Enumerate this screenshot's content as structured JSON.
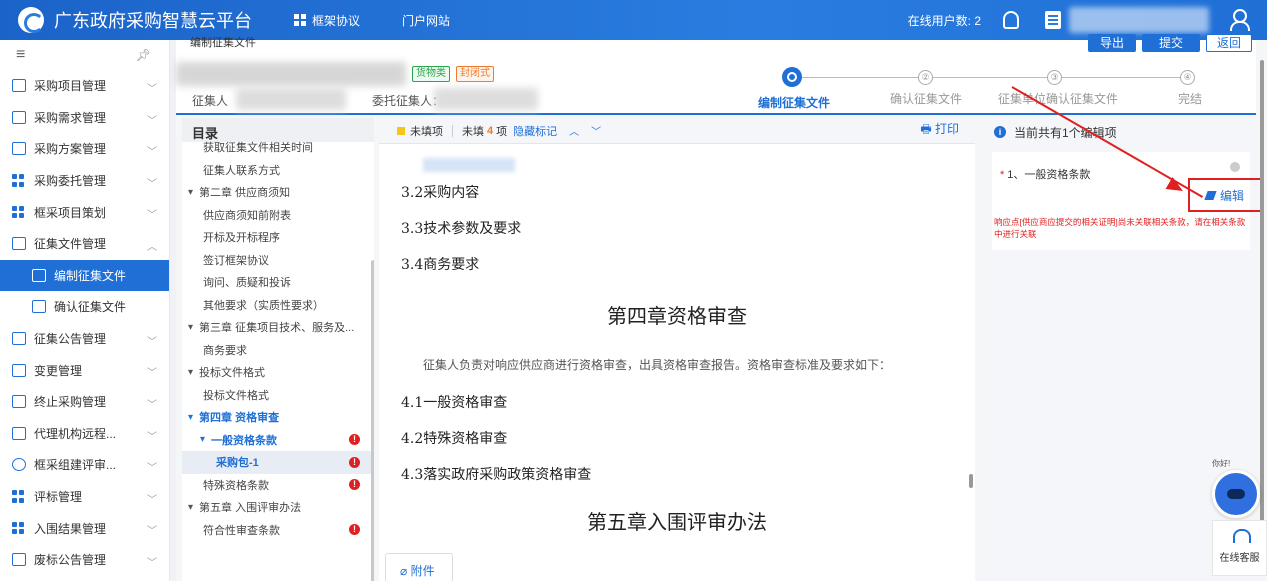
{
  "app": {
    "title": "广东政府采购智慧云平台"
  },
  "topnav": {
    "items": [
      "框架协议",
      "门户网站"
    ]
  },
  "topright": {
    "online_label": "在线用户数: 2"
  },
  "sidebar": {
    "items": [
      {
        "label": "采购项目管理",
        "icon": "folder-icon"
      },
      {
        "label": "采购需求管理",
        "icon": "doc-icon"
      },
      {
        "label": "采购方案管理",
        "icon": "doc-icon"
      },
      {
        "label": "采购委托管理",
        "icon": "grid-icon"
      },
      {
        "label": "框采项目策划",
        "icon": "grid-icon"
      },
      {
        "label": "征集文件管理",
        "icon": "doc-icon"
      },
      {
        "label": "编制征集文件",
        "icon": "edit-doc-icon"
      },
      {
        "label": "确认征集文件",
        "icon": "doc-icon"
      },
      {
        "label": "征集公告管理",
        "icon": "doc-icon"
      },
      {
        "label": "变更管理",
        "icon": "doc-icon"
      },
      {
        "label": "终止采购管理",
        "icon": "doc-icon"
      },
      {
        "label": "代理机构远程...",
        "icon": "doc-icon"
      },
      {
        "label": "框采组建评审...",
        "icon": "person-icon"
      },
      {
        "label": "评标管理",
        "icon": "grid-icon"
      },
      {
        "label": "入围结果管理",
        "icon": "grid-icon"
      },
      {
        "label": "废标公告管理",
        "icon": "doc-icon"
      }
    ]
  },
  "header": {
    "page_tag": "编制征集文件",
    "buttons": [
      "导出",
      "提交",
      "返回"
    ],
    "tags": [
      "货物类",
      "封闭式"
    ],
    "collector_label": "征集人",
    "entrusted_label": "委托征集人："
  },
  "steps": [
    "编制征集文件",
    "确认征集文件",
    "征集单位确认征集文件",
    "完结"
  ],
  "step_numbers": [
    "②",
    "③",
    "④"
  ],
  "toc": {
    "title": "目录",
    "items": [
      "获取征集文件相关时间",
      "征集人联系方式",
      "第二章 供应商须知",
      "供应商须知前附表",
      "开标及开标程序",
      "签订框架协议",
      "询问、质疑和投诉",
      "其他要求（实质性要求）",
      "第三章 征集项目技术、服务及...",
      "商务要求",
      "投标文件格式",
      "投标文件格式",
      "第四章 资格审查",
      "一般资格条款",
      "采购包-1",
      "特殊资格条款",
      "第五章 入围评审办法",
      "符合性审查条款"
    ]
  },
  "doc_toolbar": {
    "unfilled": "未填项",
    "unfilled_count_pre": "未填",
    "unfilled_count": "4",
    "unfilled_count_post": "项",
    "hide_marks": "隐藏标记",
    "print": "打印"
  },
  "doc": {
    "lines": [
      "3.2采购内容",
      "3.3技术参数及要求",
      "3.4商务要求"
    ],
    "chapter4": "第四章资格审查",
    "para": "征集人负责对响应供应商进行资格审查，出具资格审查报告。资格审查标准及要求如下：",
    "sections": [
      "4.1一般资格审查",
      "4.2特殊资格审查",
      "4.3落实政府采购政策资格审查"
    ],
    "chapter5": "第五章入围评审办法",
    "attach": "附件"
  },
  "panel": {
    "head": "当前共有1个编辑项",
    "item": "1、一般资格条款",
    "edit": "编辑",
    "warn": "响应点[供应商应提交的相关证明]尚未关联相关条款，请在相关条款中进行关联"
  },
  "widgets": {
    "bot_bubble": "你好!",
    "service": "在线客服"
  },
  "colors": {
    "primary": "#1f6fd6",
    "warning": "#e02020",
    "accent_orange": "#f07a2a"
  }
}
